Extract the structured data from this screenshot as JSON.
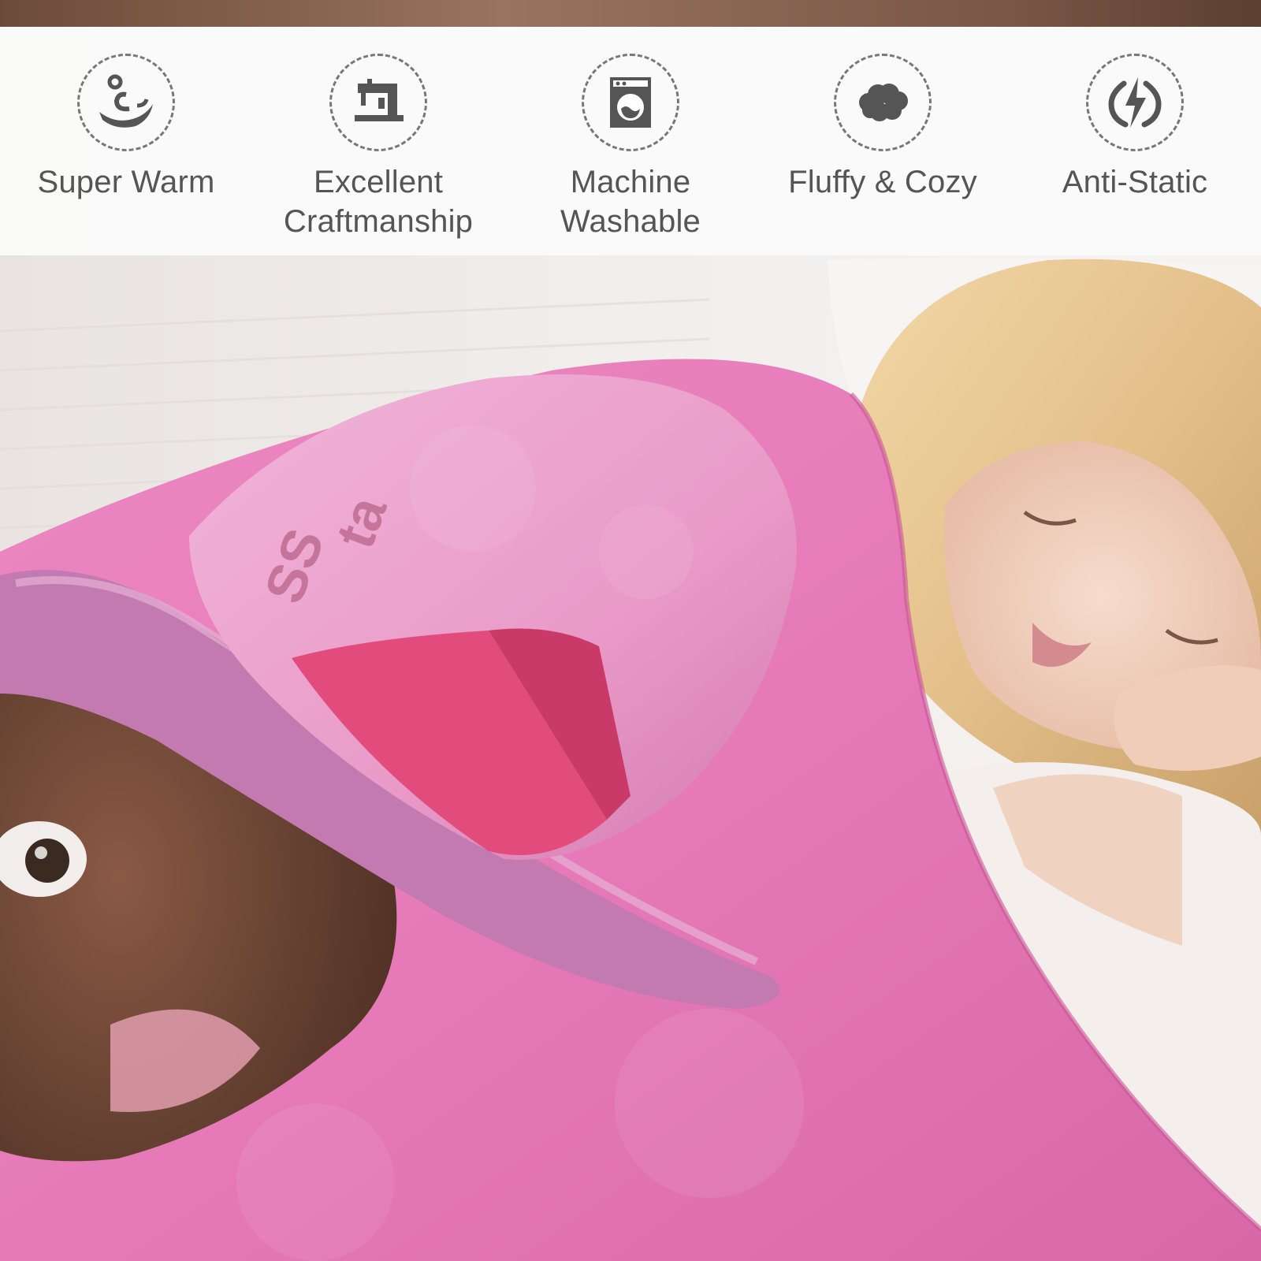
{
  "features": [
    {
      "label": "Super Warm",
      "icon": "warm-swirl-icon"
    },
    {
      "label": "Excellent\nCraftmanship",
      "icon": "sewing-machine-icon"
    },
    {
      "label": "Machine\nWashable",
      "icon": "washing-machine-icon"
    },
    {
      "label": "Fluffy & Cozy",
      "icon": "cloud-icon"
    },
    {
      "label": "Anti-Static",
      "icon": "lightning-icon"
    }
  ],
  "colors": {
    "blanket_pink": "#e67ab8",
    "blanket_pink_dark": "#cf5e9f",
    "label_gray": "#555555",
    "icon_gray": "#555555"
  }
}
